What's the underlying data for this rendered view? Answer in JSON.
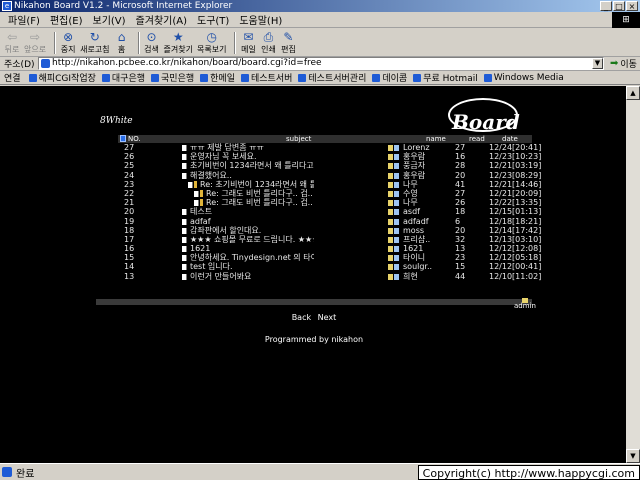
{
  "window": {
    "title": "Nikahon Board V1.2 - Microsoft Internet Explorer",
    "controls": [
      "_",
      "□",
      "×"
    ]
  },
  "menu": [
    "파일(F)",
    "편집(E)",
    "보기(V)",
    "즐겨찾기(A)",
    "도구(T)",
    "도움말(H)"
  ],
  "toolbar": [
    {
      "label": "뒤로",
      "icon": "back-arrow-icon",
      "glyph": "⇦",
      "disabled": true
    },
    {
      "label": "앞으로",
      "icon": "forward-arrow-icon",
      "glyph": "⇨",
      "disabled": true
    },
    {
      "label": "중지",
      "icon": "stop-icon",
      "glyph": "⊗",
      "disabled": false
    },
    {
      "label": "새로고침",
      "icon": "refresh-icon",
      "glyph": "↻",
      "disabled": false
    },
    {
      "label": "홈",
      "icon": "home-icon",
      "glyph": "⌂",
      "disabled": false
    },
    {
      "label": "검색",
      "icon": "search-icon",
      "glyph": "⊙",
      "disabled": false
    },
    {
      "label": "즐겨찾기",
      "icon": "favorites-icon",
      "glyph": "★",
      "disabled": false
    },
    {
      "label": "목록보기",
      "icon": "history-icon",
      "glyph": "◷",
      "disabled": false
    },
    {
      "label": "메일",
      "icon": "mail-icon",
      "glyph": "✉",
      "disabled": false
    },
    {
      "label": "인쇄",
      "icon": "print-icon",
      "glyph": "⎙",
      "disabled": false
    },
    {
      "label": "편집",
      "icon": "edit-icon",
      "glyph": "✎",
      "disabled": false
    }
  ],
  "address": {
    "label": "주소(D)",
    "url": "http://nikahon.pcbee.co.kr/nikahon/board/board.cgi?id=free",
    "go_label": "이동"
  },
  "links": {
    "label": "연결",
    "items": [
      "해피CGI작업장",
      "대구은행",
      "국민은행",
      "한메일",
      "테스트서버",
      "테스트서버관리",
      "데이콤",
      "무료 Hotmail",
      "Windows Media"
    ]
  },
  "board": {
    "brand": "8White",
    "logo": "Board",
    "columns": {
      "no": "NO.",
      "subject": "subject",
      "name": "name",
      "read": "read",
      "date": "date"
    },
    "rows": [
      {
        "no": "27",
        "subject": "ㅠㅠ 제발 답변좀 ㅠㅠ",
        "name": "Lorenz",
        "read": "27",
        "date": "12/24[20:41]",
        "depth": 0
      },
      {
        "no": "26",
        "subject": "운영자님 꼭 보세요.",
        "name": "홍우람",
        "read": "16",
        "date": "12/23[10:23]",
        "depth": 0
      },
      {
        "no": "25",
        "subject": "초기비번이 1234라면서 왜 틀리다고 나오죠....",
        "name": "풍금자",
        "read": "28",
        "date": "12/21[03:19]",
        "depth": 0
      },
      {
        "no": "24",
        "subject": "해결했어요..",
        "name": "홍우람",
        "read": "20",
        "date": "12/23[08:29]",
        "depth": 0
      },
      {
        "no": "23",
        "subject": "Re: 초기비번이 1234라면서 왜 틀리다고 나?....",
        "name": "나무",
        "read": "41",
        "date": "12/21[14:46]",
        "depth": 1
      },
      {
        "no": "22",
        "subject": "Re: 그래도 비번 틀리다구.. 겁.. T_T",
        "name": "수영",
        "read": "27",
        "date": "12/21[20:09]",
        "depth": 2
      },
      {
        "no": "21",
        "subject": "Re: 그래도 비번 틀리다구.. 겁.. T_T",
        "name": "나무",
        "read": "26",
        "date": "12/22[13:35]",
        "depth": 2
      },
      {
        "no": "20",
        "subject": "테스트",
        "name": "asdf",
        "read": "18",
        "date": "12/15[01:13]",
        "depth": 0
      },
      {
        "no": "19",
        "subject": "adfaf",
        "name": "adfadf",
        "read": "6",
        "date": "12/18[18:21]",
        "depth": 0
      },
      {
        "no": "18",
        "subject": "감좌판에서 할인대요.",
        "name": "moss",
        "read": "20",
        "date": "12/14[17:42]",
        "depth": 0
      },
      {
        "no": "17",
        "subject": "★★★ 쇼핑몰 무료로 드립니다. ★★★",
        "name": "프리샵..",
        "read": "32",
        "date": "12/13[03:10]",
        "depth": 0
      },
      {
        "no": "16",
        "subject": "1621",
        "name": "1621",
        "read": "13",
        "date": "12/12[12:08]",
        "depth": 0
      },
      {
        "no": "15",
        "subject": "안녕하세요. Tinydesign.net 의 타이니 입?....",
        "name": "타이니",
        "read": "23",
        "date": "12/12[05:18]",
        "depth": 0
      },
      {
        "no": "14",
        "subject": "test 입니다.",
        "name": "soulgr..",
        "read": "15",
        "date": "12/12[00:41]",
        "depth": 0
      },
      {
        "no": "13",
        "subject": "이런거 만들어봐요",
        "name": "희현",
        "read": "44",
        "date": "12/10[11:02]",
        "depth": 0
      }
    ],
    "admin_label": "admin",
    "nav": {
      "back": "Back",
      "next": "Next"
    },
    "credit": "Programmed by nikahon"
  },
  "status": {
    "text": "완료",
    "copyright": "Copyright(c) http://www.happycgi.com"
  }
}
